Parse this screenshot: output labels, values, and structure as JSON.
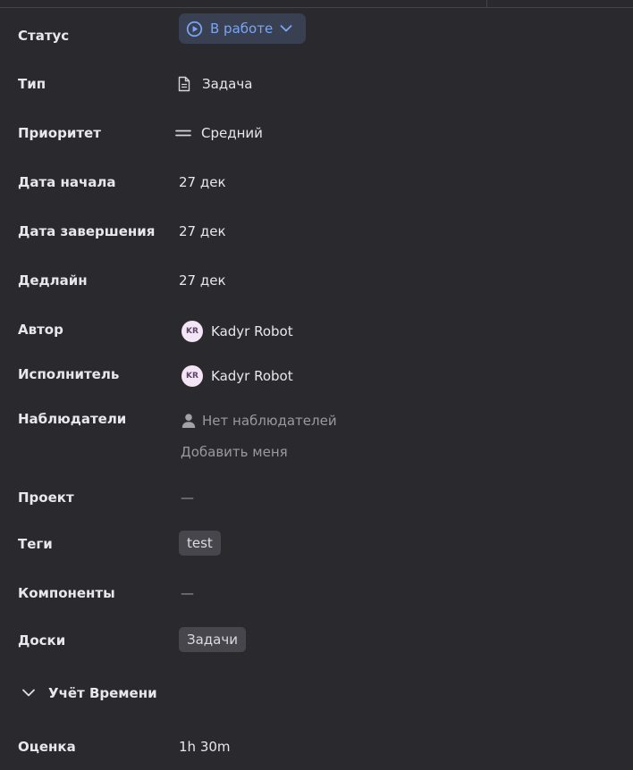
{
  "fields": {
    "status": {
      "label": "Статус",
      "value": "В работе"
    },
    "type": {
      "label": "Тип",
      "value": "Задача"
    },
    "priority": {
      "label": "Приоритет",
      "value": "Средний"
    },
    "start_date": {
      "label": "Дата начала",
      "value": "27 дек"
    },
    "end_date": {
      "label": "Дата завершения",
      "value": "27 дек"
    },
    "deadline": {
      "label": "Дедлайн",
      "value": "27 дек"
    },
    "author": {
      "label": "Автор",
      "initials": "KR",
      "name": "Kadyr Robot"
    },
    "assignee": {
      "label": "Исполнитель",
      "initials": "KR",
      "name": "Kadyr Robot"
    },
    "watchers": {
      "label": "Наблюдатели",
      "empty_text": "Нет наблюдателей",
      "add_me": "Добавить меня"
    },
    "project": {
      "label": "Проект",
      "value": "—"
    },
    "tags": {
      "label": "Теги",
      "items": [
        "test"
      ]
    },
    "components": {
      "label": "Компоненты",
      "value": "—"
    },
    "boards": {
      "label": "Доски",
      "items": [
        "Задачи"
      ]
    }
  },
  "time_tracking": {
    "section_title": "Учёт Времени",
    "estimate": {
      "label": "Оценка",
      "value": "1h 30m"
    }
  },
  "colors": {
    "background": "#2a292e",
    "status_bg": "#384052",
    "status_text": "#7ba4f6",
    "chip_bg": "#47464c",
    "avatar_bg": "#f3e4f6"
  },
  "icons": {
    "status": "play-circle-icon",
    "type": "document-icon",
    "priority": "equals-icon",
    "watchers": "person-icon",
    "section": "chevron-down-icon"
  }
}
